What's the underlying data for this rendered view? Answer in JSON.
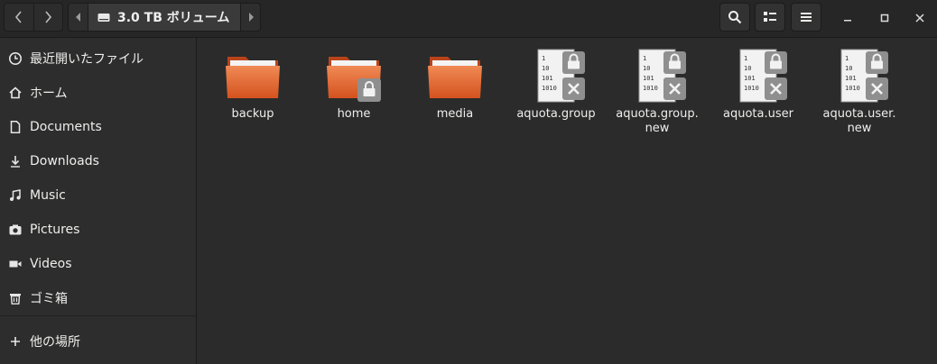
{
  "header": {
    "location_label": "3.0 TB ボリューム",
    "icons": {
      "back": "chevron-left-icon",
      "forward": "chevron-right-icon",
      "path_left": "triangle-left-icon",
      "path_right": "triangle-right-icon",
      "drive": "drive-icon",
      "search": "search-icon",
      "view": "view-options-icon",
      "menu": "hamburger-menu-icon",
      "minimize": "minimize-icon",
      "maximize": "maximize-icon",
      "close": "close-icon"
    }
  },
  "sidebar": {
    "items": [
      {
        "label": "最近開いたファイル",
        "icon": "clock-icon"
      },
      {
        "label": "ホーム",
        "icon": "home-icon"
      },
      {
        "label": "Documents",
        "icon": "document-icon"
      },
      {
        "label": "Downloads",
        "icon": "download-icon"
      },
      {
        "label": "Music",
        "icon": "music-icon"
      },
      {
        "label": "Pictures",
        "icon": "camera-icon"
      },
      {
        "label": "Videos",
        "icon": "video-icon"
      },
      {
        "label": "ゴミ箱",
        "icon": "trash-icon"
      }
    ],
    "other_locations": {
      "label": "他の場所",
      "icon": "plus-icon"
    }
  },
  "files": [
    {
      "name": "backup",
      "type": "folder",
      "locked": false
    },
    {
      "name": "home",
      "type": "folder",
      "locked": true
    },
    {
      "name": "media",
      "type": "folder",
      "locked": false
    },
    {
      "name": "aquota.group",
      "type": "binary",
      "locked": true
    },
    {
      "name": "aquota.group.\nnew",
      "type": "binary",
      "locked": true
    },
    {
      "name": "aquota.user",
      "type": "binary",
      "locked": true
    },
    {
      "name": "aquota.user.\nnew",
      "type": "binary",
      "locked": true
    }
  ],
  "binary_icon_text": [
    "1",
    "10",
    "101",
    "1010"
  ],
  "colors": {
    "folder_orange": "#e4662b",
    "folder_tab": "#f0a37b",
    "accent_bg": "#2b2b2b"
  }
}
